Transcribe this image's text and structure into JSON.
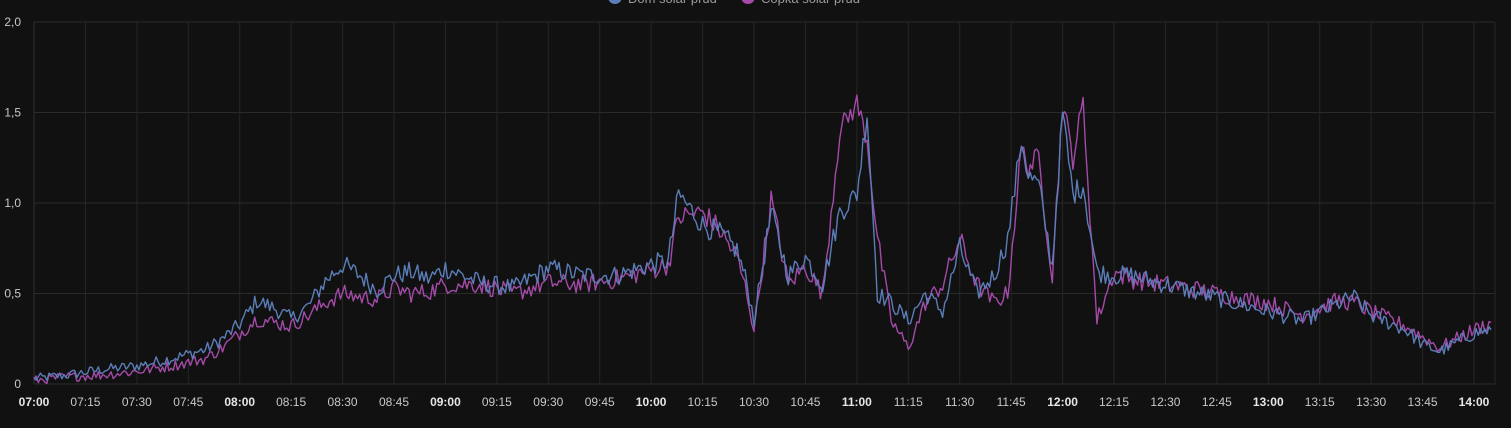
{
  "chart_data": {
    "type": "line",
    "title": "",
    "xlabel": "",
    "ylabel": "",
    "ylim": [
      0,
      2
    ],
    "xlim": [
      "07:00",
      "14:05"
    ],
    "grid": true,
    "legend_position": "top-center",
    "y_ticks": [
      "0",
      "0,5",
      "1,0",
      "1,5",
      "2,0"
    ],
    "y_tick_values": [
      0,
      0.5,
      1.0,
      1.5,
      2.0
    ],
    "x_ticks": [
      {
        "label": "07:00",
        "bold": true
      },
      {
        "label": "07:15",
        "bold": false
      },
      {
        "label": "07:30",
        "bold": false
      },
      {
        "label": "07:45",
        "bold": false
      },
      {
        "label": "08:00",
        "bold": true
      },
      {
        "label": "08:15",
        "bold": false
      },
      {
        "label": "08:30",
        "bold": false
      },
      {
        "label": "08:45",
        "bold": false
      },
      {
        "label": "09:00",
        "bold": true
      },
      {
        "label": "09:15",
        "bold": false
      },
      {
        "label": "09:30",
        "bold": false
      },
      {
        "label": "09:45",
        "bold": false
      },
      {
        "label": "10:00",
        "bold": true
      },
      {
        "label": "10:15",
        "bold": false
      },
      {
        "label": "10:30",
        "bold": false
      },
      {
        "label": "10:45",
        "bold": false
      },
      {
        "label": "11:00",
        "bold": true
      },
      {
        "label": "11:15",
        "bold": false
      },
      {
        "label": "11:30",
        "bold": false
      },
      {
        "label": "11:45",
        "bold": false
      },
      {
        "label": "12:00",
        "bold": true
      },
      {
        "label": "12:15",
        "bold": false
      },
      {
        "label": "12:30",
        "bold": false
      },
      {
        "label": "12:45",
        "bold": false
      },
      {
        "label": "13:00",
        "bold": true
      },
      {
        "label": "13:15",
        "bold": false
      },
      {
        "label": "13:30",
        "bold": false
      },
      {
        "label": "13:45",
        "bold": false
      },
      {
        "label": "14:00",
        "bold": true
      }
    ],
    "series": [
      {
        "name": "Dom solar prud",
        "color": "#5b7db8",
        "x": [
          "07:00",
          "07:10",
          "07:20",
          "07:30",
          "07:40",
          "07:50",
          "07:55",
          "08:00",
          "08:05",
          "08:10",
          "08:15",
          "08:20",
          "08:25",
          "08:30",
          "08:35",
          "08:40",
          "08:45",
          "08:50",
          "08:55",
          "09:00",
          "09:10",
          "09:20",
          "09:30",
          "09:40",
          "09:50",
          "10:00",
          "10:05",
          "10:08",
          "10:15",
          "10:20",
          "10:25",
          "10:28",
          "10:30",
          "10:35",
          "10:40",
          "10:45",
          "10:50",
          "10:55",
          "11:00",
          "11:03",
          "11:06",
          "11:10",
          "11:15",
          "11:20",
          "11:25",
          "11:30",
          "11:35",
          "11:40",
          "11:44",
          "11:48",
          "11:50",
          "11:53",
          "11:57",
          "12:00",
          "12:03",
          "12:06",
          "12:10",
          "12:15",
          "12:20",
          "12:30",
          "12:40",
          "12:50",
          "13:00",
          "13:10",
          "13:20",
          "13:25",
          "13:30",
          "13:40",
          "13:45",
          "13:50",
          "14:00",
          "14:05"
        ],
        "values": [
          0.03,
          0.05,
          0.08,
          0.1,
          0.14,
          0.19,
          0.25,
          0.33,
          0.46,
          0.42,
          0.36,
          0.43,
          0.57,
          0.66,
          0.6,
          0.52,
          0.6,
          0.62,
          0.58,
          0.64,
          0.56,
          0.53,
          0.64,
          0.6,
          0.6,
          0.66,
          0.68,
          1.05,
          0.88,
          0.83,
          0.74,
          0.55,
          0.35,
          0.95,
          0.6,
          0.7,
          0.55,
          0.95,
          1.05,
          1.5,
          0.5,
          0.45,
          0.35,
          0.5,
          0.4,
          0.75,
          0.5,
          0.6,
          0.8,
          1.35,
          1.15,
          1.1,
          0.65,
          1.5,
          1.05,
          1.1,
          0.62,
          0.6,
          0.6,
          0.55,
          0.5,
          0.45,
          0.4,
          0.35,
          0.44,
          0.48,
          0.38,
          0.3,
          0.22,
          0.18,
          0.28,
          0.3
        ]
      },
      {
        "name": "Copka solar prud",
        "color": "#a44aa8",
        "x": [
          "07:00",
          "07:10",
          "07:20",
          "07:30",
          "07:40",
          "07:50",
          "07:55",
          "08:00",
          "08:05",
          "08:10",
          "08:15",
          "08:20",
          "08:25",
          "08:30",
          "08:35",
          "08:40",
          "08:45",
          "08:50",
          "08:55",
          "09:00",
          "09:10",
          "09:20",
          "09:30",
          "09:40",
          "09:50",
          "10:00",
          "10:05",
          "10:08",
          "10:15",
          "10:20",
          "10:25",
          "10:28",
          "10:30",
          "10:35",
          "10:40",
          "10:45",
          "10:50",
          "10:55",
          "11:00",
          "11:03",
          "11:06",
          "11:10",
          "11:15",
          "11:20",
          "11:25",
          "11:30",
          "11:35",
          "11:40",
          "11:44",
          "11:48",
          "11:50",
          "11:53",
          "11:57",
          "12:00",
          "12:03",
          "12:06",
          "12:10",
          "12:15",
          "12:20",
          "12:30",
          "12:40",
          "12:50",
          "13:00",
          "13:10",
          "13:20",
          "13:25",
          "13:30",
          "13:40",
          "13:45",
          "13:50",
          "14:00",
          "14:05"
        ],
        "values": [
          0.02,
          0.04,
          0.05,
          0.07,
          0.1,
          0.14,
          0.2,
          0.28,
          0.36,
          0.34,
          0.32,
          0.38,
          0.45,
          0.5,
          0.48,
          0.47,
          0.53,
          0.5,
          0.51,
          0.55,
          0.55,
          0.5,
          0.56,
          0.55,
          0.58,
          0.63,
          0.66,
          0.92,
          0.95,
          0.85,
          0.7,
          0.5,
          0.3,
          1.02,
          0.55,
          0.65,
          0.5,
          1.4,
          1.55,
          1.35,
          0.8,
          0.35,
          0.2,
          0.45,
          0.55,
          0.8,
          0.55,
          0.45,
          0.5,
          1.3,
          1.2,
          1.25,
          0.6,
          1.55,
          1.25,
          1.55,
          0.35,
          0.62,
          0.58,
          0.55,
          0.52,
          0.48,
          0.45,
          0.38,
          0.46,
          0.45,
          0.4,
          0.32,
          0.26,
          0.2,
          0.3,
          0.34
        ]
      }
    ]
  }
}
